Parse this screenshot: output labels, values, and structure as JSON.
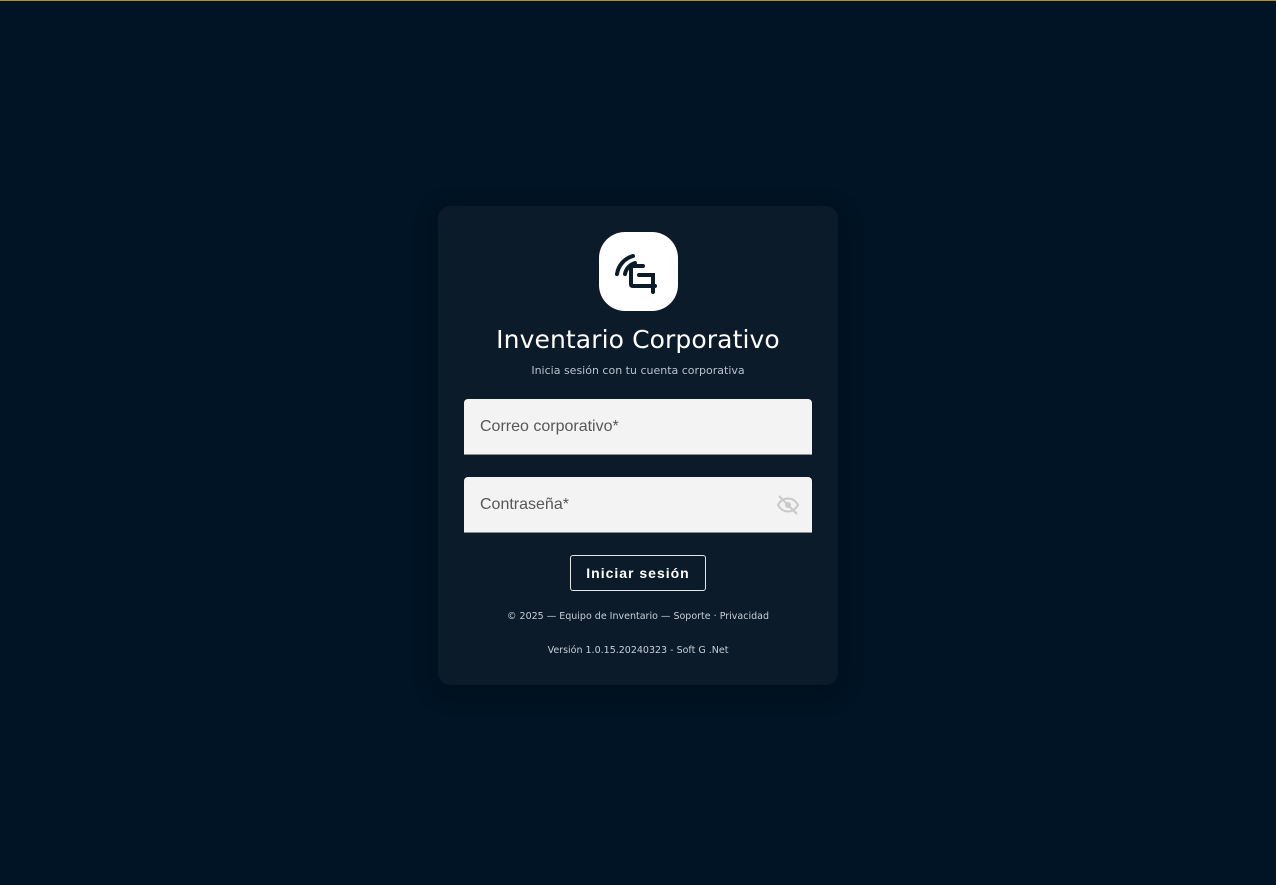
{
  "brand": {
    "logo_icon": "stylized-g-signal-logo",
    "title": "Inventario Corporativo",
    "subtitle": "Inicia sesión con tu cuenta corporativa"
  },
  "form": {
    "email_placeholder": "Correo corporativo*",
    "email_value": "",
    "password_placeholder": "Contraseña*",
    "password_value": "",
    "password_toggle_icon": "eye-off-icon",
    "submit_label": "Iniciar sesión"
  },
  "footer": {
    "copyright": "© 2025 — Equipo de Inventario — ",
    "support_link": "Soporte",
    "separator": " · ",
    "privacy_link": "Privacidad",
    "version": "Versión 1.0.15.20240323 - Soft G .Net"
  },
  "colors": {
    "background": "#011425",
    "card": "#0b1b2a",
    "accent_line": "#b08f2a",
    "field_background": "#f3f3f3"
  }
}
